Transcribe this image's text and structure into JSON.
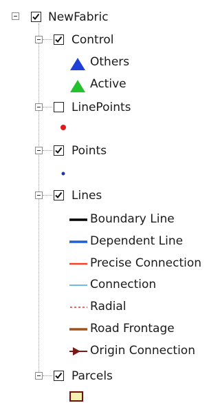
{
  "tree": {
    "root": {
      "label": "NewFabric",
      "checked": true,
      "expanded": true
    },
    "layers": [
      {
        "label": "Control",
        "checked": true,
        "expanded": true,
        "symbols": [
          {
            "label": "Others",
            "icon": "blue-triangle-icon",
            "color": "#1f3fd6"
          },
          {
            "label": "Active",
            "icon": "green-triangle-icon",
            "color": "#22c22a"
          }
        ]
      },
      {
        "label": "LinePoints",
        "checked": false,
        "expanded": true,
        "symbols": [
          {
            "label": "",
            "icon": "red-dot-icon",
            "color": "#e01b1b"
          }
        ]
      },
      {
        "label": "Points",
        "checked": true,
        "expanded": true,
        "symbols": [
          {
            "label": "",
            "icon": "blue-dot-icon",
            "color": "#1a3a9c"
          }
        ]
      },
      {
        "label": "Lines",
        "checked": true,
        "expanded": true,
        "symbols": [
          {
            "label": "Boundary Line",
            "icon": "black-line-icon",
            "color": "#000000"
          },
          {
            "label": "Dependent Line",
            "icon": "blue-line-icon",
            "color": "#1f5fd6"
          },
          {
            "label": "Precise Connection",
            "icon": "red-line-icon",
            "color": "#ff3b1f"
          },
          {
            "label": "Connection",
            "icon": "light-blue-line-icon",
            "color": "#3aa6e0"
          },
          {
            "label": "Radial",
            "icon": "dashed-red-line-icon",
            "color": "#c83a3a"
          },
          {
            "label": "Road Frontage",
            "icon": "brown-line-icon",
            "color": "#a0521d"
          },
          {
            "label": "Origin Connection",
            "icon": "arrow-line-icon",
            "color": "#7a1a14"
          }
        ]
      },
      {
        "label": "Parcels",
        "checked": true,
        "expanded": true,
        "symbols": [
          {
            "label": "",
            "icon": "parcel-polygon-icon",
            "color": "#f6efb0"
          }
        ]
      }
    ]
  }
}
